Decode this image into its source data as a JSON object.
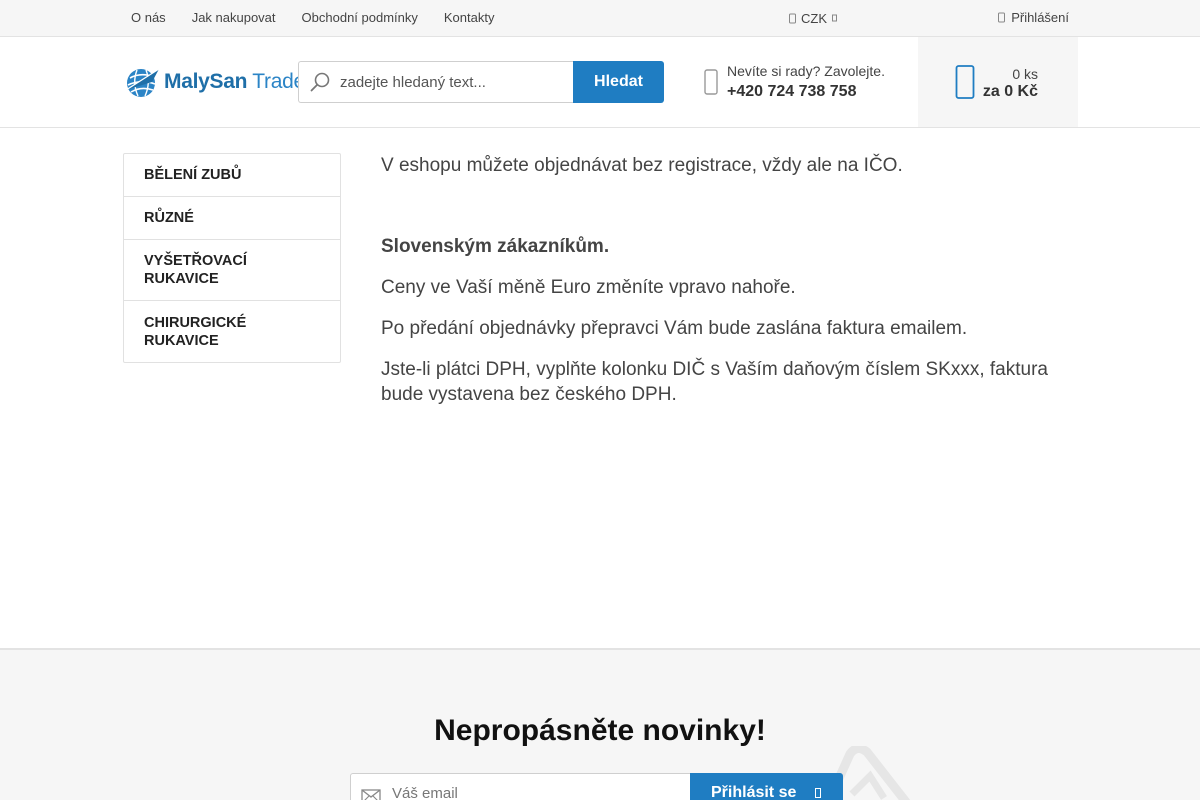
{
  "topbar": {
    "nav": [
      "O nás",
      "Jak nakupovat",
      "Obchodní podmínky",
      "Kontakty"
    ],
    "currency": "CZK",
    "currency_icon": "globe-icon",
    "login": "Přihlášení",
    "login_icon": "user-icon"
  },
  "header": {
    "logo_bold": "MalySan",
    "logo_light": " Trade",
    "search_placeholder": "zadejte hledaný text...",
    "search_button": "Hledat",
    "contact_question": "Nevíte si rady? Zavolejte.",
    "contact_phone": "+420 724 738 758",
    "cart_count": "0 ks",
    "cart_total": "za 0 Kč",
    "colors": {
      "primary": "#1f7dc2",
      "logo": "#1f6fa8"
    }
  },
  "sidebar": {
    "categories": [
      "Bělení zubů",
      "Různé",
      "Vyšetřovací rukavice",
      "Chirurgické rukavice"
    ]
  },
  "content": {
    "p1": "V eshopu můžete objednávat bez registrace, vždy ale na IČO.",
    "p2": "Slovenským zákazníkům.",
    "p3": "Ceny ve Vaší měně Euro změníte vpravo nahoře.",
    "p4": "Po předání objednávky přepravci Vám bude zaslána faktura emailem.",
    "p5": "Jste-li plátci DPH, vyplňte kolonku DIČ s Vaším daňovým číslem SKxxx, faktura bude vystavena bez českého DPH."
  },
  "newsletter": {
    "title": "Nepropásněte novinky!",
    "email_placeholder": "Váš email",
    "button": "Přihlásit se"
  }
}
